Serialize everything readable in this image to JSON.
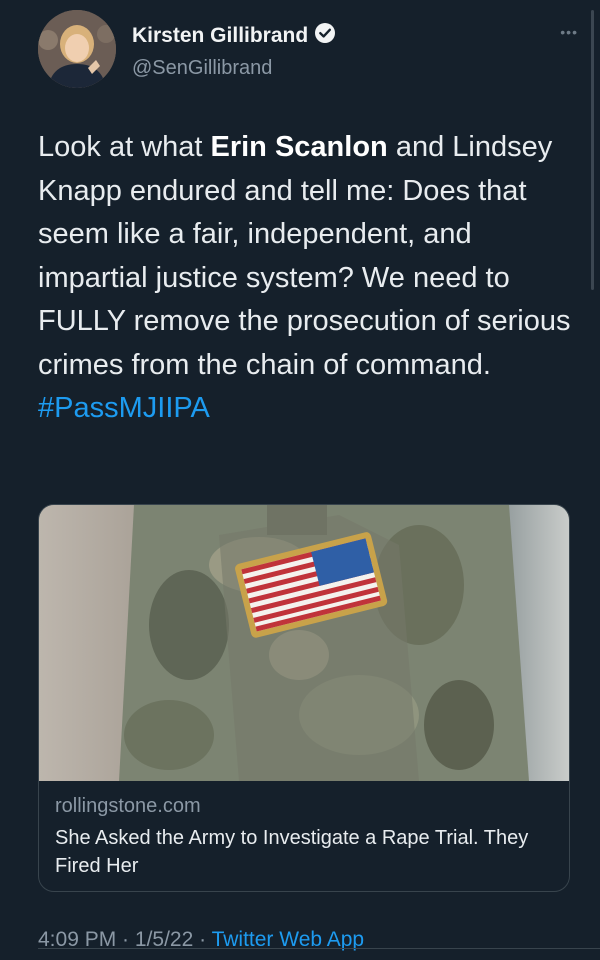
{
  "author": {
    "display_name": "Kirsten Gillibrand",
    "handle": "@SenGillibrand",
    "verified": true,
    "more_icon": "more-horizontal-icon"
  },
  "tweet": {
    "text_before": "Look at what ",
    "text_bold": "Erin Scanlon",
    "text_after": " and Lindsey Knapp endured and tell me: Does that seem like a fair, independent, and impartial justice system? We need to FULLY remove the prosecution of serious crimes from the chain of command. ",
    "hashtag": "#PassMJIIPA"
  },
  "card": {
    "domain": "rollingstone.com",
    "title": "She Asked the Army to Investigate a Rape Trial. They Fired Her"
  },
  "meta": {
    "time": "4:09 PM",
    "separator1": " · ",
    "date": "1/5/22",
    "separator2": " · ",
    "source": "Twitter Web App"
  },
  "colors": {
    "background": "#15202b",
    "link": "#1d9bf0",
    "secondary_text": "#8b98a5",
    "border": "#38444d"
  }
}
